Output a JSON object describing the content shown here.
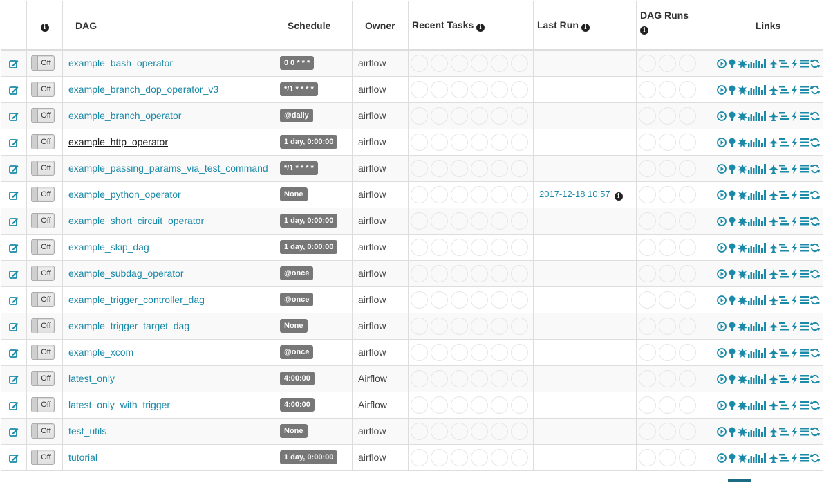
{
  "table": {
    "headers": {
      "info": "i",
      "dag": "DAG",
      "schedule": "Schedule",
      "owner": "Owner",
      "recent_tasks": "Recent Tasks",
      "last_run": "Last Run",
      "dag_runs": "DAG Runs",
      "links": "Links"
    },
    "toggle_label": "Off",
    "rows": [
      {
        "dag": "example_bash_operator",
        "schedule": "0 0 * * *",
        "owner": "airflow",
        "last_run": ""
      },
      {
        "dag": "example_branch_dop_operator_v3",
        "schedule": "*/1 * * * *",
        "owner": "airflow",
        "last_run": ""
      },
      {
        "dag": "example_branch_operator",
        "schedule": "@daily",
        "owner": "airflow",
        "last_run": ""
      },
      {
        "dag": "example_http_operator",
        "schedule": "1 day, 0:00:00",
        "owner": "airflow",
        "last_run": "",
        "hovered": true
      },
      {
        "dag": "example_passing_params_via_test_command",
        "schedule": "*/1 * * * *",
        "owner": "airflow",
        "last_run": ""
      },
      {
        "dag": "example_python_operator",
        "schedule": "None",
        "owner": "airflow",
        "last_run": "2017-12-18 10:57"
      },
      {
        "dag": "example_short_circuit_operator",
        "schedule": "1 day, 0:00:00",
        "owner": "airflow",
        "last_run": ""
      },
      {
        "dag": "example_skip_dag",
        "schedule": "1 day, 0:00:00",
        "owner": "airflow",
        "last_run": ""
      },
      {
        "dag": "example_subdag_operator",
        "schedule": "@once",
        "owner": "airflow",
        "last_run": ""
      },
      {
        "dag": "example_trigger_controller_dag",
        "schedule": "@once",
        "owner": "airflow",
        "last_run": ""
      },
      {
        "dag": "example_trigger_target_dag",
        "schedule": "None",
        "owner": "airflow",
        "last_run": ""
      },
      {
        "dag": "example_xcom",
        "schedule": "@once",
        "owner": "airflow",
        "last_run": ""
      },
      {
        "dag": "latest_only",
        "schedule": "4:00:00",
        "owner": "Airflow",
        "last_run": ""
      },
      {
        "dag": "latest_only_with_trigger",
        "schedule": "4:00:00",
        "owner": "Airflow",
        "last_run": ""
      },
      {
        "dag": "test_utils",
        "schedule": "None",
        "owner": "airflow",
        "last_run": ""
      },
      {
        "dag": "tutorial",
        "schedule": "1 day, 0:00:00",
        "owner": "airflow",
        "last_run": ""
      }
    ],
    "recent_task_circles": 6,
    "dag_run_circles": 3,
    "link_icons": [
      "trigger-dag-icon",
      "tree-view-icon",
      "graph-view-icon",
      "task-duration-icon",
      "task-tries-icon",
      "landing-times-icon",
      "gantt-icon",
      "code-view-icon",
      "logs-icon",
      "refresh-icon"
    ]
  },
  "colors": {
    "accent": "#1b8aa8",
    "badge": "#777777",
    "border": "#dddddd",
    "stripe": "#f9f9f9"
  }
}
